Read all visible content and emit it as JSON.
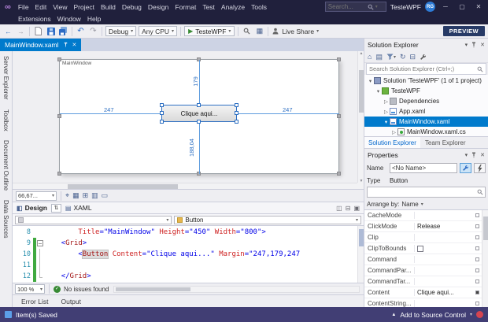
{
  "titlebar": {
    "menus_row1": [
      "File",
      "Edit",
      "View",
      "Project",
      "Build",
      "Debug",
      "Design",
      "Format",
      "Test",
      "Analyze",
      "Tools"
    ],
    "menus_row2": [
      "Extensions",
      "Window",
      "Help"
    ],
    "search_placeholder": "Search...",
    "window_title": "TesteWPF",
    "avatar": "RG"
  },
  "toolbar": {
    "config": "Debug",
    "platform": "Any CPU",
    "start": "TesteWPF",
    "live_share": "Live Share",
    "preview": "PREVIEW"
  },
  "left_tabs": [
    "Server Explorer",
    "Toolbox",
    "Document Outline",
    "Data Sources"
  ],
  "doc_tab": "MainWindow.xaml",
  "designer": {
    "window_title": "MainWindow",
    "button_text": "Clique aqui...",
    "margin_left": "247",
    "margin_right": "247",
    "margin_top": "179",
    "margin_bottom": "188,04",
    "zoom": "66,67..."
  },
  "view_tabs": {
    "design": "Design",
    "xaml": "XAML"
  },
  "breadcrumb": {
    "element": "Button"
  },
  "editor": {
    "zoom": "100 %",
    "health": "No issues found",
    "lines": [
      {
        "num": "8",
        "marks": [],
        "tokens": [
          [
            "ws",
            "        "
          ],
          [
            "attr",
            "Title"
          ],
          [
            "delim",
            "="
          ],
          [
            "val",
            "\"MainWindow\""
          ],
          [
            "ws",
            " "
          ],
          [
            "attr",
            "Height"
          ],
          [
            "delim",
            "="
          ],
          [
            "val",
            "\"450\""
          ],
          [
            "ws",
            " "
          ],
          [
            "attr",
            "Width"
          ],
          [
            "delim",
            "="
          ],
          [
            "val",
            "\"800\""
          ],
          [
            "delim",
            ">"
          ]
        ]
      },
      {
        "num": "9",
        "marks": [
          "change",
          "collapse"
        ],
        "tokens": [
          [
            "ws",
            "    "
          ],
          [
            "delim",
            "<"
          ],
          [
            "name",
            "Grid"
          ],
          [
            "delim",
            ">"
          ]
        ]
      },
      {
        "num": "10",
        "marks": [
          "change",
          "guide"
        ],
        "tokens": [
          [
            "ws",
            "        "
          ],
          [
            "delim",
            "<"
          ],
          [
            "name-hl",
            "Button"
          ],
          [
            "ws",
            " "
          ],
          [
            "attr",
            "Content"
          ],
          [
            "delim",
            "="
          ],
          [
            "val",
            "\"Clique aqui...\""
          ],
          [
            "ws",
            " "
          ],
          [
            "attr",
            "Margin"
          ],
          [
            "delim",
            "="
          ],
          [
            "val",
            "\"247,179,247"
          ]
        ]
      },
      {
        "num": "11",
        "marks": [
          "change",
          "guide"
        ],
        "tokens": []
      },
      {
        "num": "12",
        "marks": [
          "change",
          "guide-end"
        ],
        "tokens": [
          [
            "ws",
            "    "
          ],
          [
            "delim",
            "</"
          ],
          [
            "name",
            "Grid"
          ],
          [
            "delim",
            ">"
          ]
        ]
      }
    ]
  },
  "panel_tabs": [
    "Error List",
    "Output"
  ],
  "solution_explorer": {
    "title": "Solution Explorer",
    "search_placeholder": "Search Solution Explorer (Ctrl+;)",
    "tree": [
      {
        "label": "Solution 'TesteWPF' (1 of 1 project)",
        "indent": 0,
        "expander": "expanded",
        "icon": "solution-icon",
        "selected": false
      },
      {
        "label": "TesteWPF",
        "indent": 1,
        "expander": "expanded",
        "icon": "project-icon",
        "selected": false
      },
      {
        "label": "Dependencies",
        "indent": 2,
        "expander": "collapsed",
        "icon": "dependencies-icon",
        "selected": false
      },
      {
        "label": "App.xaml",
        "indent": 2,
        "expander": "collapsed",
        "icon": "xaml-icon",
        "selected": false
      },
      {
        "label": "MainWindow.xaml",
        "indent": 2,
        "expander": "expanded",
        "icon": "xaml-icon",
        "selected": true
      },
      {
        "label": "MainWindow.xaml.cs",
        "indent": 3,
        "expander": "collapsed",
        "icon": "cs-icon",
        "selected": false
      }
    ]
  },
  "bottom_right_tabs": [
    "Solution Explorer",
    "Team Explorer"
  ],
  "properties": {
    "title": "Properties",
    "name_label": "Name",
    "name_value": "<No Name>",
    "type_label": "Type",
    "type_value": "Button",
    "arrange_label": "Arrange by:",
    "arrange_value": "Name",
    "rows": [
      {
        "key": "CacheMode",
        "value": "",
        "control": "combo",
        "local": false
      },
      {
        "key": "ClickMode",
        "value": "Release",
        "control": "combo",
        "local": false
      },
      {
        "key": "Clip",
        "value": "",
        "control": "text",
        "local": false
      },
      {
        "key": "ClipToBounds",
        "value": "",
        "control": "checkbox",
        "local": false
      },
      {
        "key": "Command",
        "value": "",
        "control": "text",
        "local": false
      },
      {
        "key": "CommandPar...",
        "value": "",
        "control": "text",
        "local": false
      },
      {
        "key": "CommandTar...",
        "value": "",
        "control": "text",
        "local": false
      },
      {
        "key": "Content",
        "value": "Clique aqui...",
        "control": "text",
        "local": true
      },
      {
        "key": "ContentString...",
        "value": "",
        "control": "text",
        "local": false
      }
    ]
  },
  "statusbar": {
    "left": "Item(s) Saved",
    "source_control": "Add to Source Control"
  }
}
